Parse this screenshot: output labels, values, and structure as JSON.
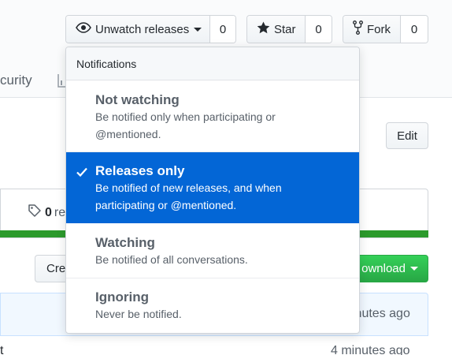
{
  "actions": {
    "watch_label": "Unwatch releases",
    "watch_count": "0",
    "star_label": "Star",
    "star_count": "0",
    "fork_label": "Fork",
    "fork_count": "0"
  },
  "background": {
    "security_tab_fragment": "curity",
    "edit_label": "Edit",
    "releases_count": "0",
    "releases_label_fragment": "re",
    "create_label_fragment": "Crea",
    "download_label_fragment": "ownload",
    "commit_time_fragment": "inutes ago",
    "file_row_fragment": "t",
    "file_row_time": "4 minutes ago",
    "language_bar_color": "#2c9a2c"
  },
  "menu": {
    "header": "Notifications",
    "items": [
      {
        "title": "Not watching",
        "desc_line1": "Be notified only when participating or",
        "desc_line2": "@mentioned.",
        "selected": false
      },
      {
        "title": "Releases only",
        "desc_line1": "Be notified of new releases, and when",
        "desc_line2": "participating or @mentioned.",
        "selected": true
      },
      {
        "title": "Watching",
        "desc_line1": "Be notified of all conversations.",
        "selected": false
      },
      {
        "title": "Ignoring",
        "desc_line1": "Never be notified.",
        "selected": false
      }
    ]
  },
  "colors": {
    "selected_bg": "#0366d6",
    "primary_green": "#28a745"
  },
  "icons": [
    "eye-icon",
    "star-icon",
    "repo-forked-icon",
    "tag-icon",
    "graph-icon",
    "check-icon",
    "triangle-down-icon"
  ]
}
